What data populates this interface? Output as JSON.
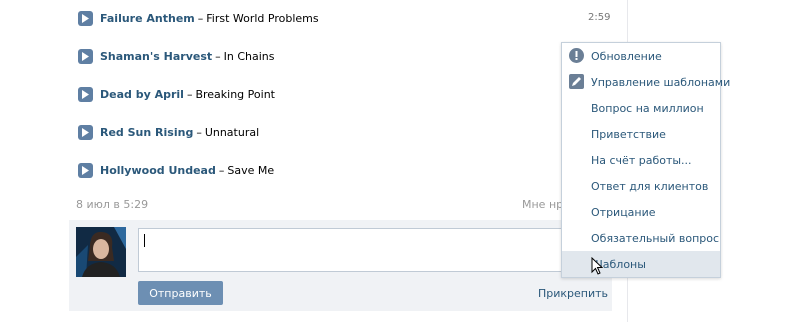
{
  "tracks": [
    {
      "artist": "Failure Anthem",
      "title": "First World Problems",
      "duration": "2:59"
    },
    {
      "artist": "Shaman's Harvest",
      "title": "In Chains"
    },
    {
      "artist": "Dead by April",
      "title": "Breaking Point"
    },
    {
      "artist": "Red Sun Rising",
      "title": "Unnatural"
    },
    {
      "artist": "Hollywood Undead",
      "title": "Save Me"
    }
  ],
  "separator": "–",
  "post_meta": {
    "date": "8 июл в 5:29",
    "like_label": "Мне нравится"
  },
  "reply": {
    "send_label": "Отправить",
    "attach_label": "Прикрепить",
    "input_value": ""
  },
  "menu": {
    "items": [
      {
        "label": "Обновление",
        "icon": "exclamation-circle-icon"
      },
      {
        "label": "Управление шаблонами",
        "icon": "pencil-icon"
      },
      {
        "label": "Вопрос на миллион"
      },
      {
        "label": "Приветствие"
      },
      {
        "label": "На счёт работы..."
      },
      {
        "label": "Ответ для клиентов"
      },
      {
        "label": "Отрицание"
      },
      {
        "label": "Обязательный вопрос"
      },
      {
        "label": "Шаблоны",
        "state": "hovered"
      }
    ]
  },
  "colors": {
    "link": "#2b587a",
    "button": "#6d8fb3",
    "hover": "#e1e7ed",
    "play": "#5f7fa3"
  }
}
